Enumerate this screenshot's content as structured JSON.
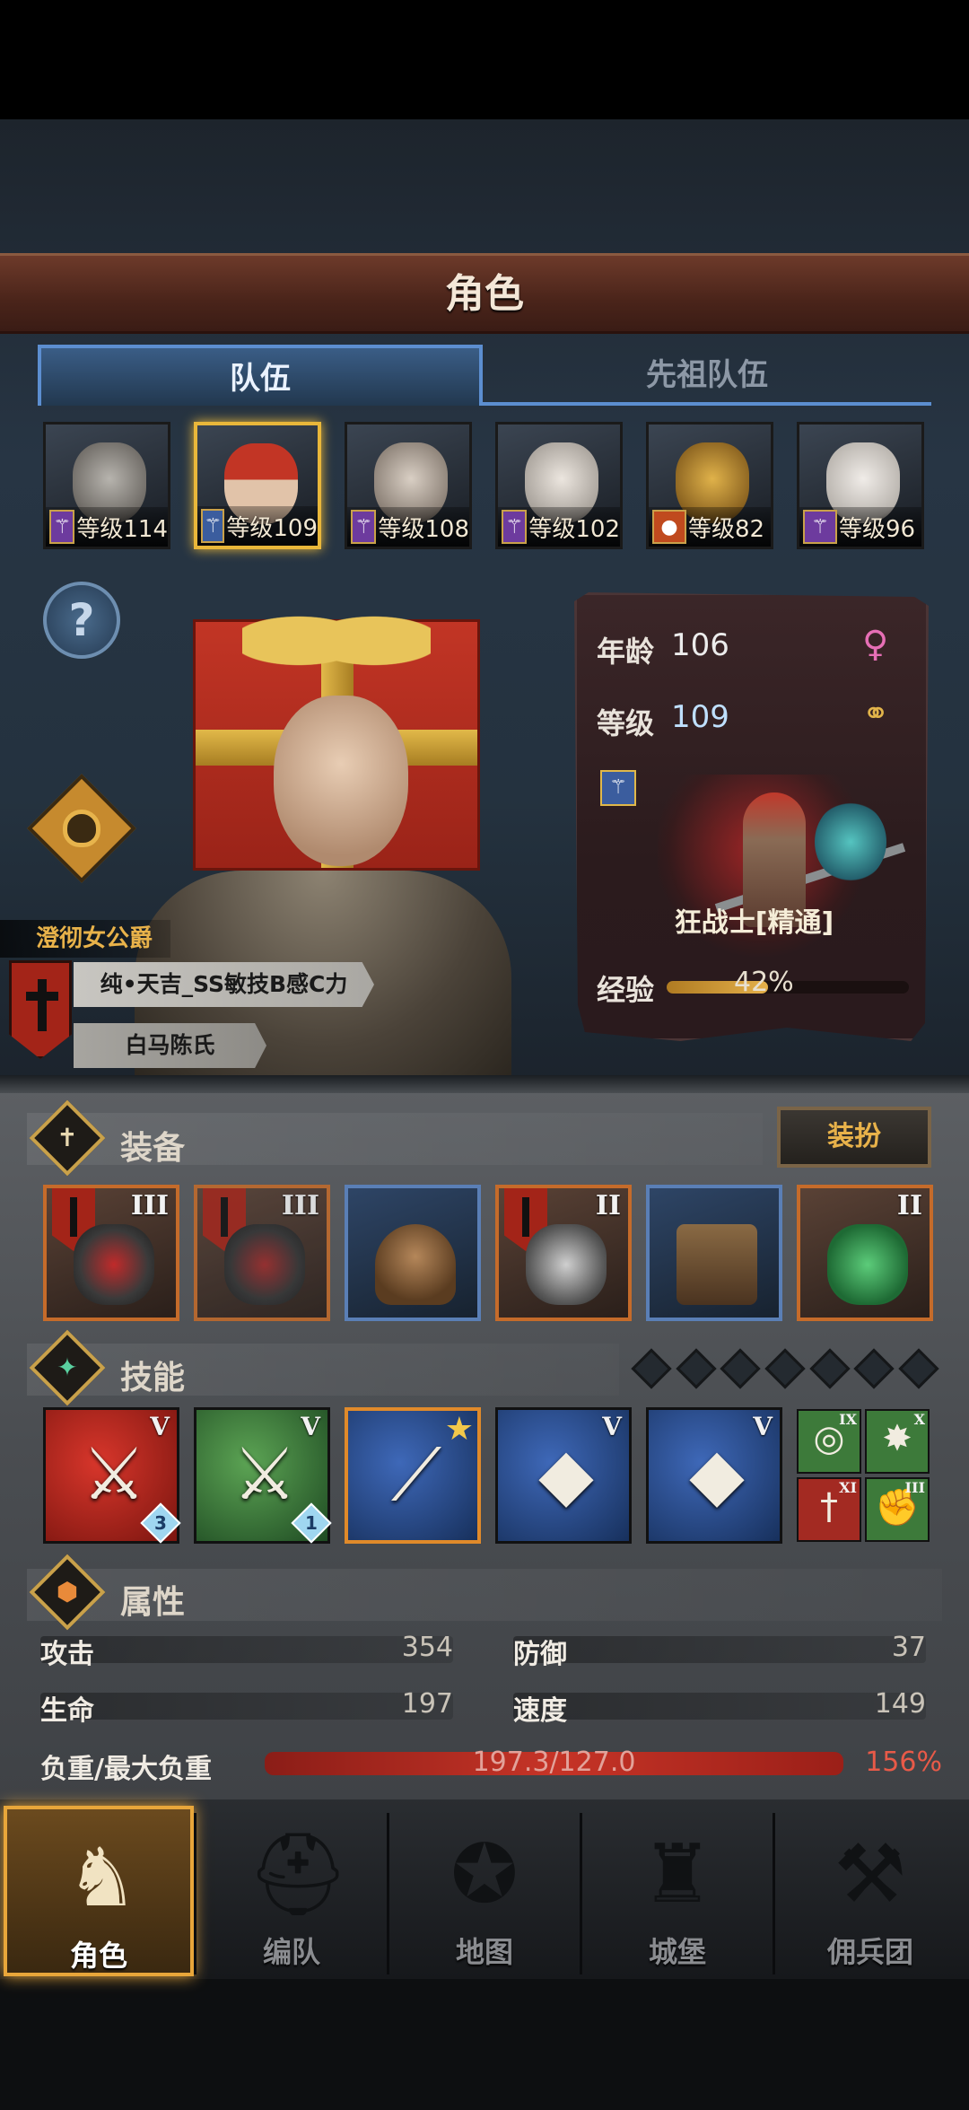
{
  "header": {
    "title": "角色"
  },
  "tabs": [
    {
      "label": "队伍",
      "active": true
    },
    {
      "label": "先祖队伍",
      "active": false
    }
  ],
  "heroes": [
    {
      "level_text": "等级114",
      "class_icon": "wand-icon",
      "selected": false
    },
    {
      "level_text": "等级109",
      "class_icon": "wand-icon",
      "selected": true
    },
    {
      "level_text": "等级108",
      "class_icon": "wand-icon",
      "selected": false
    },
    {
      "level_text": "等级102",
      "class_icon": "wand-icon",
      "selected": false
    },
    {
      "level_text": "等级82",
      "class_icon": "bear-icon",
      "selected": false
    },
    {
      "level_text": "等级96",
      "class_icon": "wand-icon",
      "selected": false
    }
  ],
  "character": {
    "title": "澄彻女公爵",
    "name": "纯•天吉_SS敏技B感C力",
    "family": "白马陈氏",
    "age_label": "年龄",
    "age": "106",
    "level_label": "等级",
    "level": "109",
    "class_name": "狂战士[精通]",
    "exp_label": "经验",
    "exp_text": "42%",
    "exp_fraction": 0.42
  },
  "equipment": {
    "title": "装备",
    "dress_button": "装扮",
    "slots": [
      {
        "tier": "III",
        "flag": true,
        "rarity": "orange"
      },
      {
        "tier": "III",
        "flag": true,
        "rarity": "orange"
      },
      {
        "tier": "",
        "flag": false,
        "rarity": "blue"
      },
      {
        "tier": "II",
        "flag": true,
        "rarity": "orange"
      },
      {
        "tier": "",
        "flag": false,
        "rarity": "blue"
      },
      {
        "tier": "II",
        "flag": false,
        "rarity": "orange"
      }
    ]
  },
  "skills": {
    "title": "技能",
    "items": [
      {
        "tier": "V",
        "gem": "3",
        "color": "red"
      },
      {
        "tier": "V",
        "gem": "1",
        "color": "green"
      },
      {
        "tier": "",
        "gem": "",
        "color": "blue",
        "starred": true
      },
      {
        "tier": "V",
        "gem": "",
        "color": "blue"
      },
      {
        "tier": "V",
        "gem": "",
        "color": "blue"
      }
    ],
    "mini": [
      {
        "tier": "IX",
        "color": "green"
      },
      {
        "tier": "X",
        "color": "green"
      },
      {
        "tier": "XI",
        "color": "red"
      },
      {
        "tier": "III",
        "color": "green"
      }
    ]
  },
  "attributes": {
    "title": "属性",
    "attack_label": "攻击",
    "attack": "354",
    "defense_label": "防御",
    "defense": "37",
    "hp_label": "生命",
    "hp": "197",
    "speed_label": "速度",
    "speed": "149",
    "load_label": "负重/最大负重",
    "load_text": "197.3/127.0",
    "load_pct": "156%"
  },
  "nav": [
    {
      "label": "角色",
      "icon": "knight-icon",
      "active": true
    },
    {
      "label": "编队",
      "icon": "helmet-icon",
      "active": false
    },
    {
      "label": "地图",
      "icon": "compass-icon",
      "active": false
    },
    {
      "label": "城堡",
      "icon": "castle-icon",
      "active": false
    },
    {
      "label": "佣兵团",
      "icon": "mercenary-icon",
      "active": false
    }
  ],
  "colors": {
    "accent_gold": "#e8b24a",
    "tab_blue": "#5c8ed0",
    "load_red": "#c63427"
  }
}
